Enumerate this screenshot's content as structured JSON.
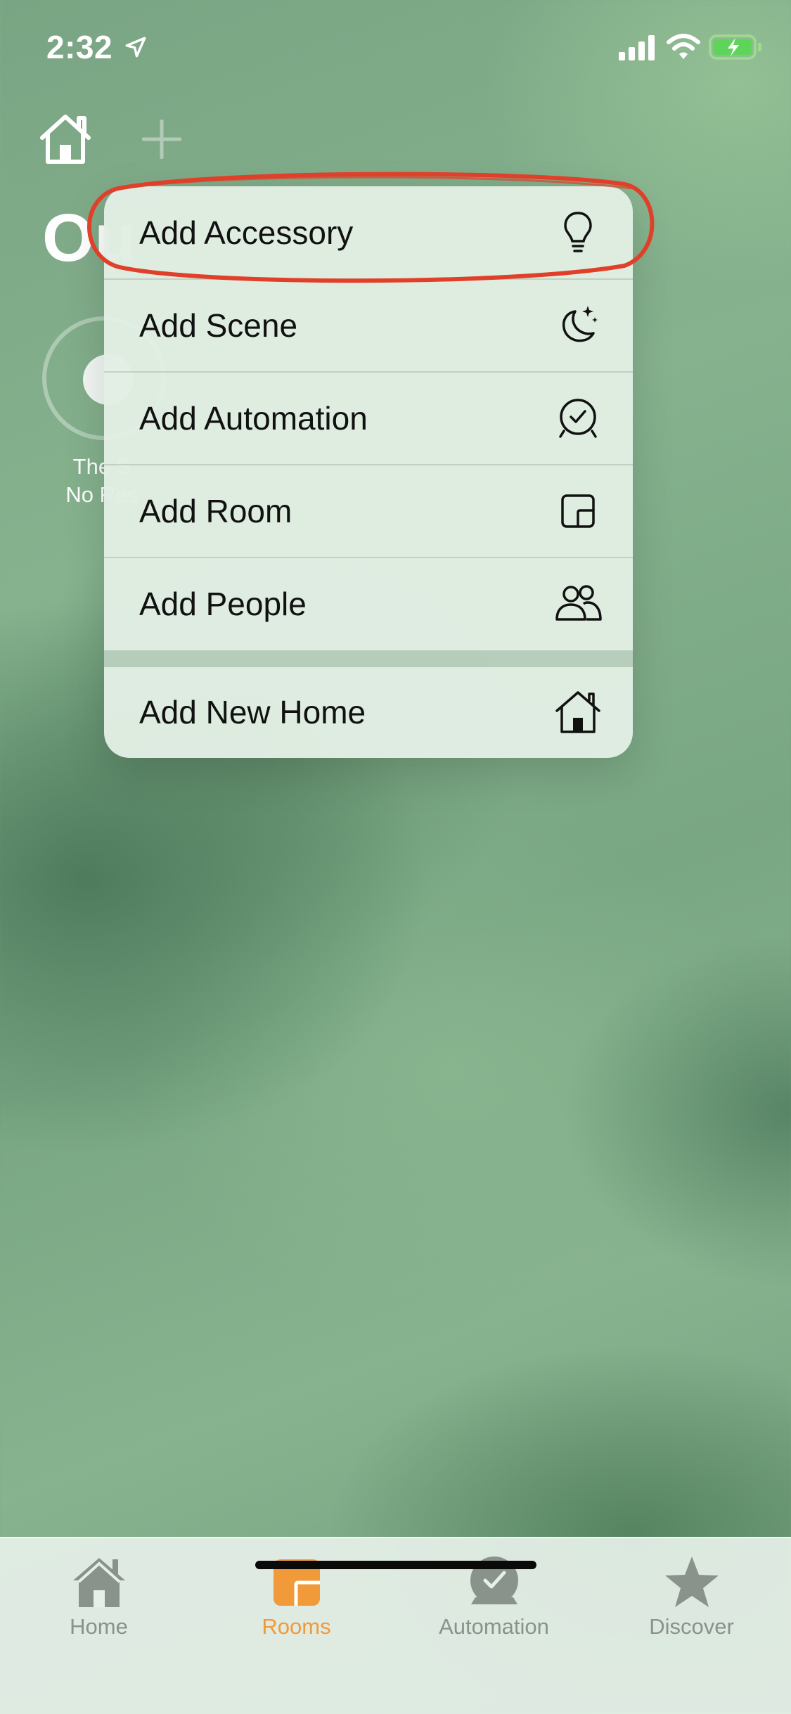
{
  "status_bar": {
    "time": "2:32"
  },
  "header": {
    "title": "Ou"
  },
  "scene": {
    "line1": "The S",
    "line2": "No Res"
  },
  "menu": {
    "items": [
      {
        "label": "Add Accessory",
        "icon": "lightbulb-icon"
      },
      {
        "label": "Add Scene",
        "icon": "moon-stars-icon"
      },
      {
        "label": "Add Automation",
        "icon": "clock-check-icon"
      },
      {
        "label": "Add Room",
        "icon": "room-icon"
      },
      {
        "label": "Add People",
        "icon": "people-icon"
      },
      {
        "label": "Add New Home",
        "icon": "house-icon"
      }
    ]
  },
  "tab_bar": {
    "tabs": [
      {
        "label": "Home",
        "icon": "house-icon",
        "active": false
      },
      {
        "label": "Rooms",
        "icon": "rooms-icon",
        "active": true
      },
      {
        "label": "Automation",
        "icon": "automation-icon",
        "active": false
      },
      {
        "label": "Discover",
        "icon": "star-icon",
        "active": false
      }
    ]
  },
  "colors": {
    "accent_active": "#f09a3a",
    "highlight_annotation": "#e0402a",
    "tab_inactive": "#8a928c"
  }
}
